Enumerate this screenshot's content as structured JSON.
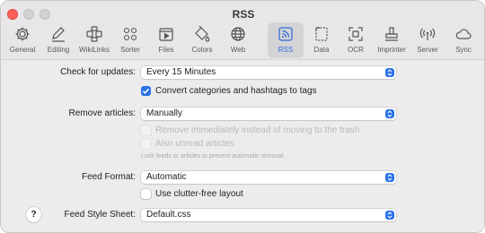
{
  "window": {
    "title": "RSS"
  },
  "toolbar": {
    "items": [
      {
        "label": "General",
        "icon": "gear-icon"
      },
      {
        "label": "Editing",
        "icon": "pencil-icon"
      },
      {
        "label": "WikiLinks",
        "icon": "wikilinks-icon"
      },
      {
        "label": "Sorter",
        "icon": "sorter-icon"
      },
      {
        "label": "Files",
        "icon": "files-icon"
      },
      {
        "label": "Colors",
        "icon": "paint-bucket-icon"
      },
      {
        "label": "Web",
        "icon": "globe-icon"
      },
      {
        "label": "RSS",
        "icon": "rss-icon",
        "selected": true
      },
      {
        "label": "Data",
        "icon": "data-icon"
      },
      {
        "label": "OCR",
        "icon": "ocr-icon"
      },
      {
        "label": "Imprinter",
        "icon": "stamp-icon"
      },
      {
        "label": "Server",
        "icon": "broadcast-icon"
      },
      {
        "label": "Sync",
        "icon": "cloud-icon"
      }
    ]
  },
  "settings": {
    "check_updates": {
      "label": "Check for updates:",
      "value": "Every 15 Minutes"
    },
    "convert_tags": {
      "label": "Convert categories and hashtags to tags",
      "checked": true
    },
    "remove_articles": {
      "label": "Remove articles:",
      "value": "Manually"
    },
    "remove_immediately": {
      "label": "Remove immediately instead of moving to the trash",
      "checked": false,
      "enabled": false
    },
    "also_unread": {
      "label": "Also unread articles",
      "checked": false,
      "enabled": false
    },
    "lock_hint": "Lock feeds or articles to prevent automatic removal.",
    "feed_format": {
      "label": "Feed Format:",
      "value": "Automatic"
    },
    "clutter_free": {
      "label": "Use clutter-free layout",
      "checked": false
    },
    "feed_style_sheet": {
      "label": "Feed Style Sheet:",
      "value": "Default.css"
    },
    "help": "?"
  },
  "colors": {
    "accent": "#2a72e8",
    "close": "#fe5f57"
  }
}
